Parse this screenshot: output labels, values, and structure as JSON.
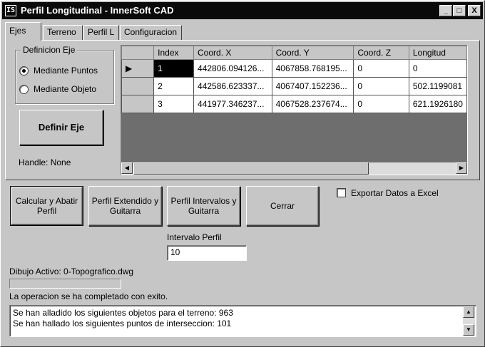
{
  "window": {
    "title": "Perfil Longitudinal - InnerSoft CAD",
    "icon_text": "IS",
    "controls": {
      "minimize": "_",
      "maximize": "□",
      "close": "X"
    }
  },
  "tabs": [
    {
      "label": "Ejes",
      "active": true
    },
    {
      "label": "Terreno",
      "active": false
    },
    {
      "label": "Perfil L",
      "active": false
    },
    {
      "label": "Configuracion",
      "active": false
    }
  ],
  "definicion_eje": {
    "legend": "Definicion Eje",
    "options": [
      {
        "label": "Mediante Puntos",
        "selected": true
      },
      {
        "label": "Mediante Objeto",
        "selected": false
      }
    ],
    "define_button": "Definir Eje",
    "handle_text": "Handle: None"
  },
  "grid": {
    "columns": [
      "Index",
      "Coord. X",
      "Coord. Y",
      "Coord. Z",
      "Longitud"
    ],
    "rows": [
      [
        "1",
        "442806.094126...",
        "4067858.768195...",
        "0",
        "0"
      ],
      [
        "2",
        "442586.623337...",
        "4067407.152236...",
        "0",
        "502.1199081"
      ],
      [
        "3",
        "441977.346237...",
        "4067528.237674...",
        "0",
        "621.1926180"
      ]
    ],
    "current_row_marker": "▶",
    "scroll_left": "◀",
    "scroll_right": "▶"
  },
  "actions": {
    "calcular": "Calcular y Abatir Perfil",
    "perfil_extendido": "Perfil Extendido y Guitarra",
    "perfil_intervalos": "Perfil Intervalos y Guitarra",
    "cerrar": "Cerrar"
  },
  "exportar": {
    "label": "Exportar Datos a Excel",
    "checked": false
  },
  "intervalo": {
    "label": "Intervalo Perfil",
    "value": "10"
  },
  "status": {
    "dibujo_activo": "Dibujo Activo: 0-Topografico.dwg",
    "progress": 0,
    "message": "La operacion se ha completado con exito."
  },
  "log": {
    "lines": [
      "Se han alladido los siguientes objetos para el terreno: 963",
      "Se han hallado los siguientes puntos de interseccion: 101"
    ],
    "scroll_up": "▲",
    "scroll_down": "▼"
  }
}
